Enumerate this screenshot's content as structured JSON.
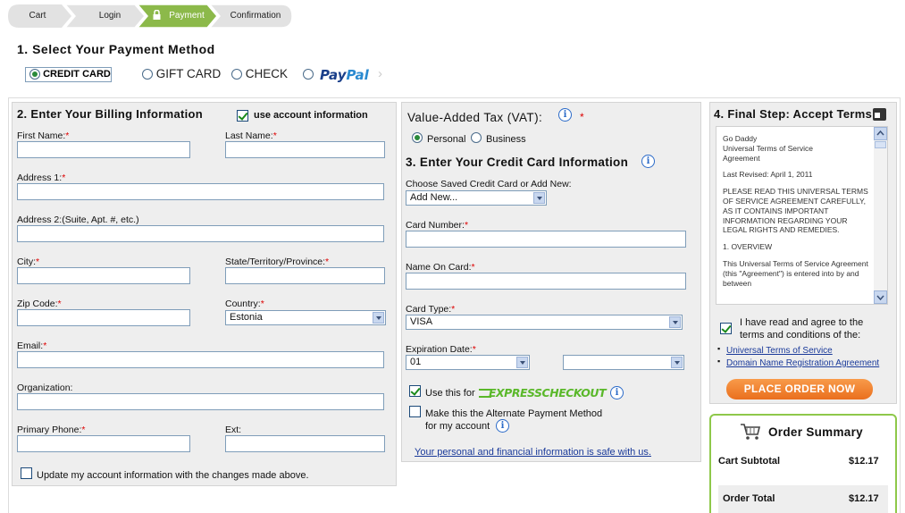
{
  "steps": [
    {
      "label": "Cart"
    },
    {
      "label": "Login"
    },
    {
      "label": "Payment"
    },
    {
      "label": "Confirmation"
    }
  ],
  "section1": {
    "title": "1. Select Your Payment Method",
    "methods": [
      {
        "label": "CREDIT CARD",
        "selected": true
      },
      {
        "label": "GIFT CARD",
        "selected": false
      },
      {
        "label": "CHECK",
        "selected": false
      },
      {
        "label": "PayPal",
        "selected": false
      }
    ],
    "paypal_part1": "Pay",
    "paypal_part2": "Pal"
  },
  "billing": {
    "title": "2. Enter Your Billing Information",
    "use_account_label": "use account information",
    "first_name": {
      "label": "First Name:",
      "value": ""
    },
    "last_name": {
      "label": "Last Name:",
      "value": ""
    },
    "address1": {
      "label": "Address 1:",
      "value": ""
    },
    "address2": {
      "label": "Address 2:(Suite, Apt. #, etc.)",
      "value": ""
    },
    "city": {
      "label": "City:",
      "value": ""
    },
    "state": {
      "label": "State/Territory/Province:",
      "value": ""
    },
    "zip": {
      "label": "Zip Code:",
      "value": ""
    },
    "country": {
      "label": "Country:",
      "value": "Estonia"
    },
    "email": {
      "label": "Email:",
      "value": ""
    },
    "organization": {
      "label": "Organization:",
      "value": ""
    },
    "phone": {
      "label": "Primary Phone:",
      "value": ""
    },
    "ext": {
      "label": "Ext:",
      "value": ""
    },
    "update_label": "Update my account information with the changes made above.",
    "required_mark": "*"
  },
  "vat": {
    "title": "Value-Added Tax (VAT):",
    "personal": "Personal",
    "business": "Business"
  },
  "credit": {
    "title": "3. Enter Your Credit Card Information",
    "saved_label": "Choose Saved Credit Card or Add New:",
    "saved_value": "Add New...",
    "card_number_label": "Card Number:",
    "name_on_card_label": "Name On Card:",
    "card_type_label": "Card Type:",
    "card_type_value": "VISA",
    "expiration_label": "Expiration Date:",
    "exp_month": "01",
    "exp_year": "",
    "use_this_for": "Use this for",
    "express_checkout": "EXPRESSCHECKOUT",
    "alternate_line1": "Make this the Alternate Payment Method",
    "alternate_line2": "for my account",
    "safe_link": "Your personal and financial information is safe with us."
  },
  "terms": {
    "title": "4. Final Step: Accept Terms",
    "text_lines": [
      "Go Daddy\nUniversal Terms of Service\nAgreement",
      "Last Revised: April 1, 2011",
      "PLEASE READ THIS UNIVERSAL TERMS OF SERVICE AGREEMENT CAREFULLY, AS IT CONTAINS IMPORTANT INFORMATION REGARDING YOUR LEGAL RIGHTS AND REMEDIES.",
      "1. OVERVIEW",
      "This Universal Terms of Service Agreement (this \"Agreement\") is entered into by and between"
    ],
    "agree_line1": "I have read and agree to the",
    "agree_line2": "terms and conditions of the:",
    "link1": "Universal Terms of Service",
    "link2": "Domain Name Registration Agreement",
    "button": "PLACE ORDER NOW"
  },
  "summary": {
    "title": "Order Summary",
    "subtotal_label": "Cart Subtotal",
    "subtotal_value": "$12.17",
    "total_label": "Order Total",
    "total_value": "$12.17"
  },
  "colors": {
    "active_step": "#8cb94a",
    "order_button": "#f0802e",
    "summary_border": "#8ec84a"
  }
}
